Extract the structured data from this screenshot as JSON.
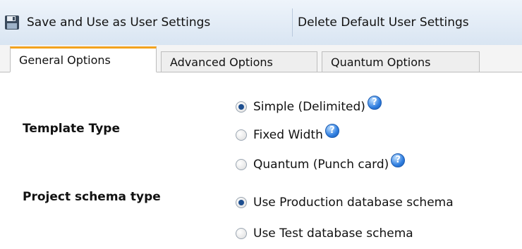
{
  "toolbar": {
    "save_label": "Save and Use as User Settings",
    "delete_label": "Delete Default User Settings",
    "save_icon": "floppy-disk-icon"
  },
  "tabs": [
    {
      "label": "General Options",
      "active": true
    },
    {
      "label": "Advanced Options",
      "active": false
    },
    {
      "label": "Quantum Options",
      "active": false
    }
  ],
  "template_type": {
    "label": "Template Type",
    "options": [
      {
        "label": "Simple (Delimited)",
        "selected": true
      },
      {
        "label": "Fixed Width",
        "selected": false
      },
      {
        "label": "Quantum (Punch card)",
        "selected": false
      }
    ]
  },
  "project_schema": {
    "label": "Project schema type",
    "options": [
      {
        "label": "Use Production database schema",
        "selected": true
      },
      {
        "label": "Use Test database schema",
        "selected": false
      }
    ]
  },
  "help_icon_glyph": "?",
  "colors": {
    "tab_accent": "#f3a31e",
    "radio_selected": "#1d4e8f",
    "help_icon": "#2f7ee0"
  }
}
